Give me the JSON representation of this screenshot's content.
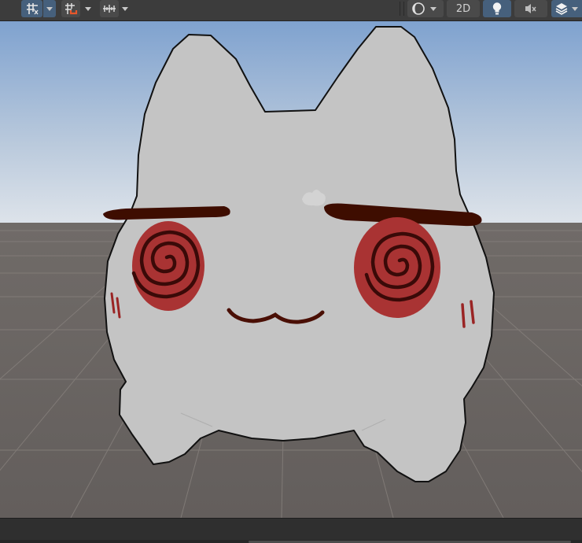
{
  "toolbar": {
    "view_mode_label": "2D",
    "buttons": [
      {
        "name": "grid-snap-button",
        "icon": "grid-snap-icon"
      },
      {
        "name": "increment-snap-button",
        "icon": "magnet-grid-icon"
      },
      {
        "name": "ruler-button",
        "icon": "ruler-icon"
      },
      {
        "name": "draw-mode-button",
        "icon": "shaded-sphere-icon"
      },
      {
        "name": "2d-toggle-button",
        "icon": "2d-icon"
      },
      {
        "name": "lighting-toggle-button",
        "icon": "light-bulb-icon"
      },
      {
        "name": "audio-toggle-button",
        "icon": "speaker-muted-icon"
      },
      {
        "name": "effects-button",
        "icon": "layers-icon"
      }
    ]
  },
  "scene": {
    "colors": {
      "sky_top": "#7fa2cf",
      "sky_horizon": "#dde3ea",
      "ground": "#676260",
      "body": "#c4c4c4",
      "eyebrow": "#3e0d00",
      "eye_fill": "#a93333",
      "spiral": "#3a0a08",
      "mouth": "#4a0f05",
      "blush": "#9a2424"
    }
  }
}
